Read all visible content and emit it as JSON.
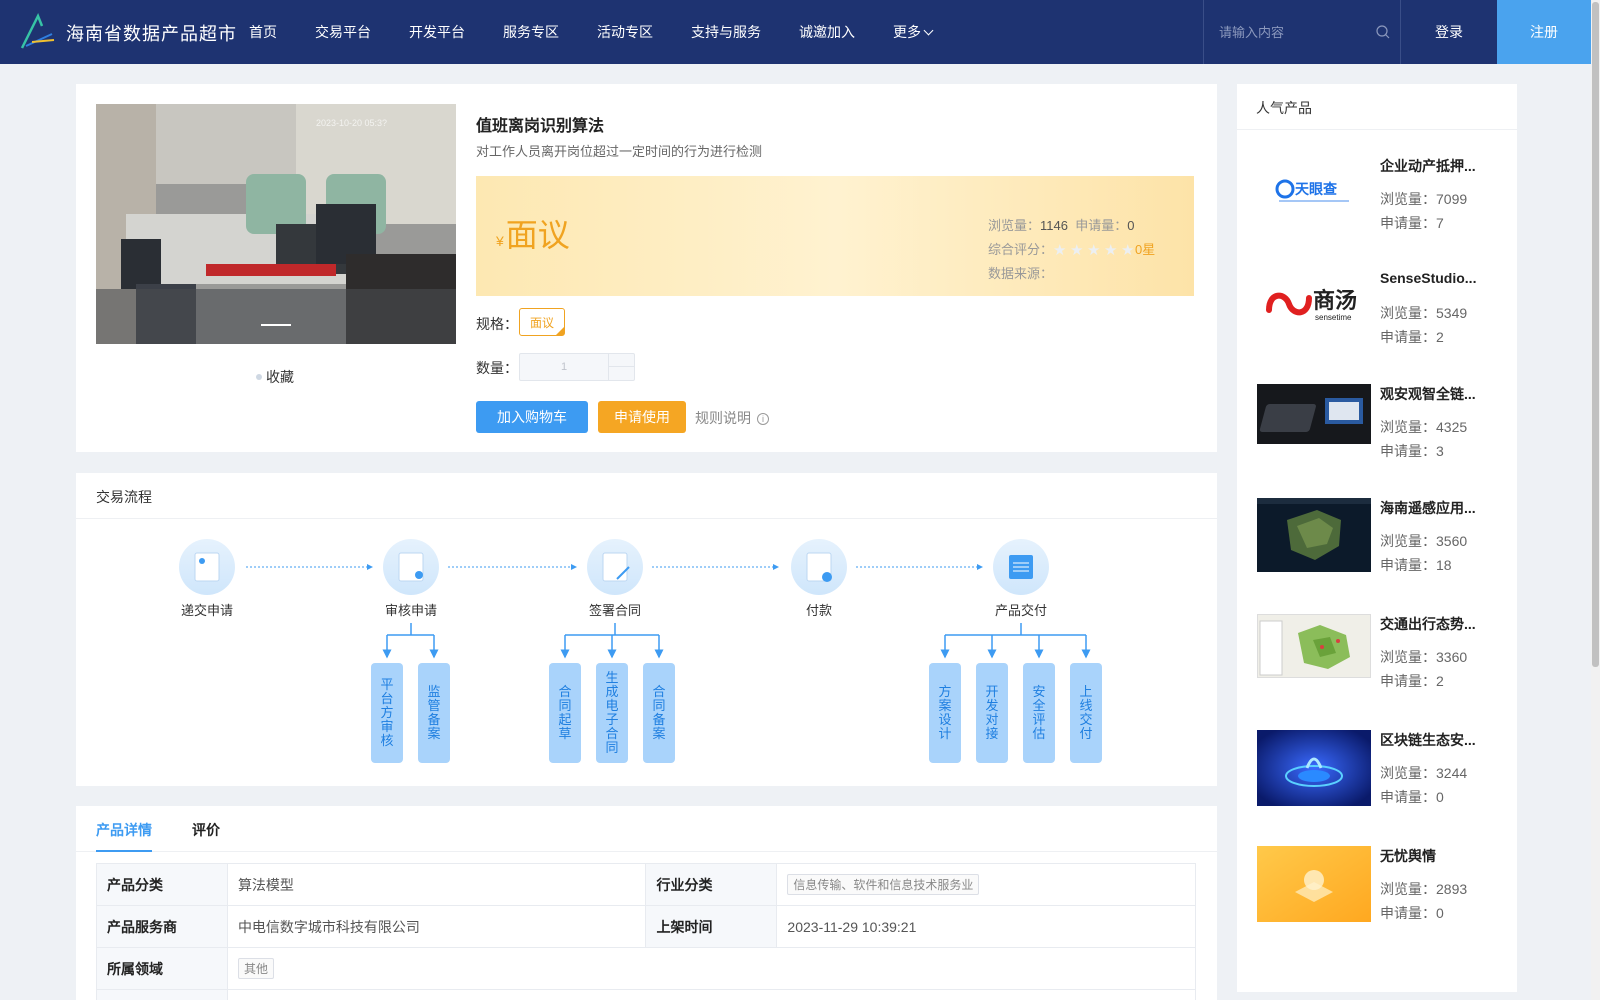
{
  "header": {
    "site_title": "海南省数据产品超市",
    "nav": [
      "首页",
      "交易平台",
      "开发平台",
      "服务专区",
      "活动专区",
      "支持与服务",
      "诚邀加入",
      "更多"
    ],
    "search_placeholder": "请输入内容",
    "login_label": "登录",
    "register_label": "注册",
    "colors": {
      "bg": "#1e3371",
      "register_bg": "#4aa3ee"
    }
  },
  "product": {
    "name": "值班离岗识别算法",
    "description": "对工作人员离开岗位超过一定时间的行为进行检测",
    "price_symbol": "¥",
    "price": "面议",
    "views_label": "浏览量：",
    "views": "1146",
    "apply_label": "申请量：",
    "apply_count": "0",
    "rating_label": "综合评分：",
    "rating_stars": 0,
    "rating_text": "0星",
    "source_label": "数据来源：",
    "spec_label": "规格：",
    "spec_value": "面议",
    "qty_label": "数量：",
    "qty_value": "1",
    "collect_label": "收藏",
    "image_timestamp": "2023-10-20 05:3?",
    "cart_button": "加入购物车",
    "apply_button": "申请使用",
    "rules_label": "规则说明"
  },
  "flow": {
    "title": "交易流程",
    "steps": [
      "递交申请",
      "审核申请",
      "签署合同",
      "付款",
      "产品交付"
    ],
    "sub_steps": {
      "审核申请": [
        "平台方审核",
        "监管备案"
      ],
      "签署合同": [
        "合同起草",
        "生成电子合同",
        "合同备案"
      ],
      "产品交付": [
        "方案设计",
        "开发对接",
        "安全评估",
        "上线交付"
      ]
    }
  },
  "detail": {
    "tabs": [
      "产品详情",
      "评价"
    ],
    "rows": [
      {
        "k1": "产品分类",
        "v1": "算法模型",
        "k2": "行业分类",
        "v2": "信息传输、软件和信息技术服务业"
      },
      {
        "k1": "产品服务商",
        "v1": "中电信数字城市科技有限公司",
        "k2": "上架时间",
        "v2": "2023-11-29 10:39:21"
      },
      {
        "k1": "所属领域",
        "v1": "其他"
      }
    ]
  },
  "popular": {
    "title": "人气产品",
    "views_label": "浏览量：",
    "apply_label": "申请量：",
    "items": [
      {
        "name": "企业动产抵押...",
        "views": "7099",
        "apply": "7",
        "thumb": "tianyancha-logo",
        "logo_text": "天眼查"
      },
      {
        "name": "SenseStudio...",
        "views": "5349",
        "apply": "2",
        "thumb": "sensetime-logo",
        "logo_text": "商汤",
        "logo_sub": "sensetime"
      },
      {
        "name": "观安观智全链...",
        "views": "4325",
        "apply": "3",
        "thumb": "device-photo"
      },
      {
        "name": "海南遥感应用...",
        "views": "3560",
        "apply": "18",
        "thumb": "satellite-map"
      },
      {
        "name": "交通出行态势...",
        "views": "3360",
        "apply": "2",
        "thumb": "traffic-map"
      },
      {
        "name": "区块链生态安...",
        "views": "3244",
        "apply": "0",
        "thumb": "blockchain-illustration"
      },
      {
        "name": "无忧舆情",
        "views": "2893",
        "apply": "0",
        "thumb": "sentiment-illustration"
      }
    ]
  }
}
